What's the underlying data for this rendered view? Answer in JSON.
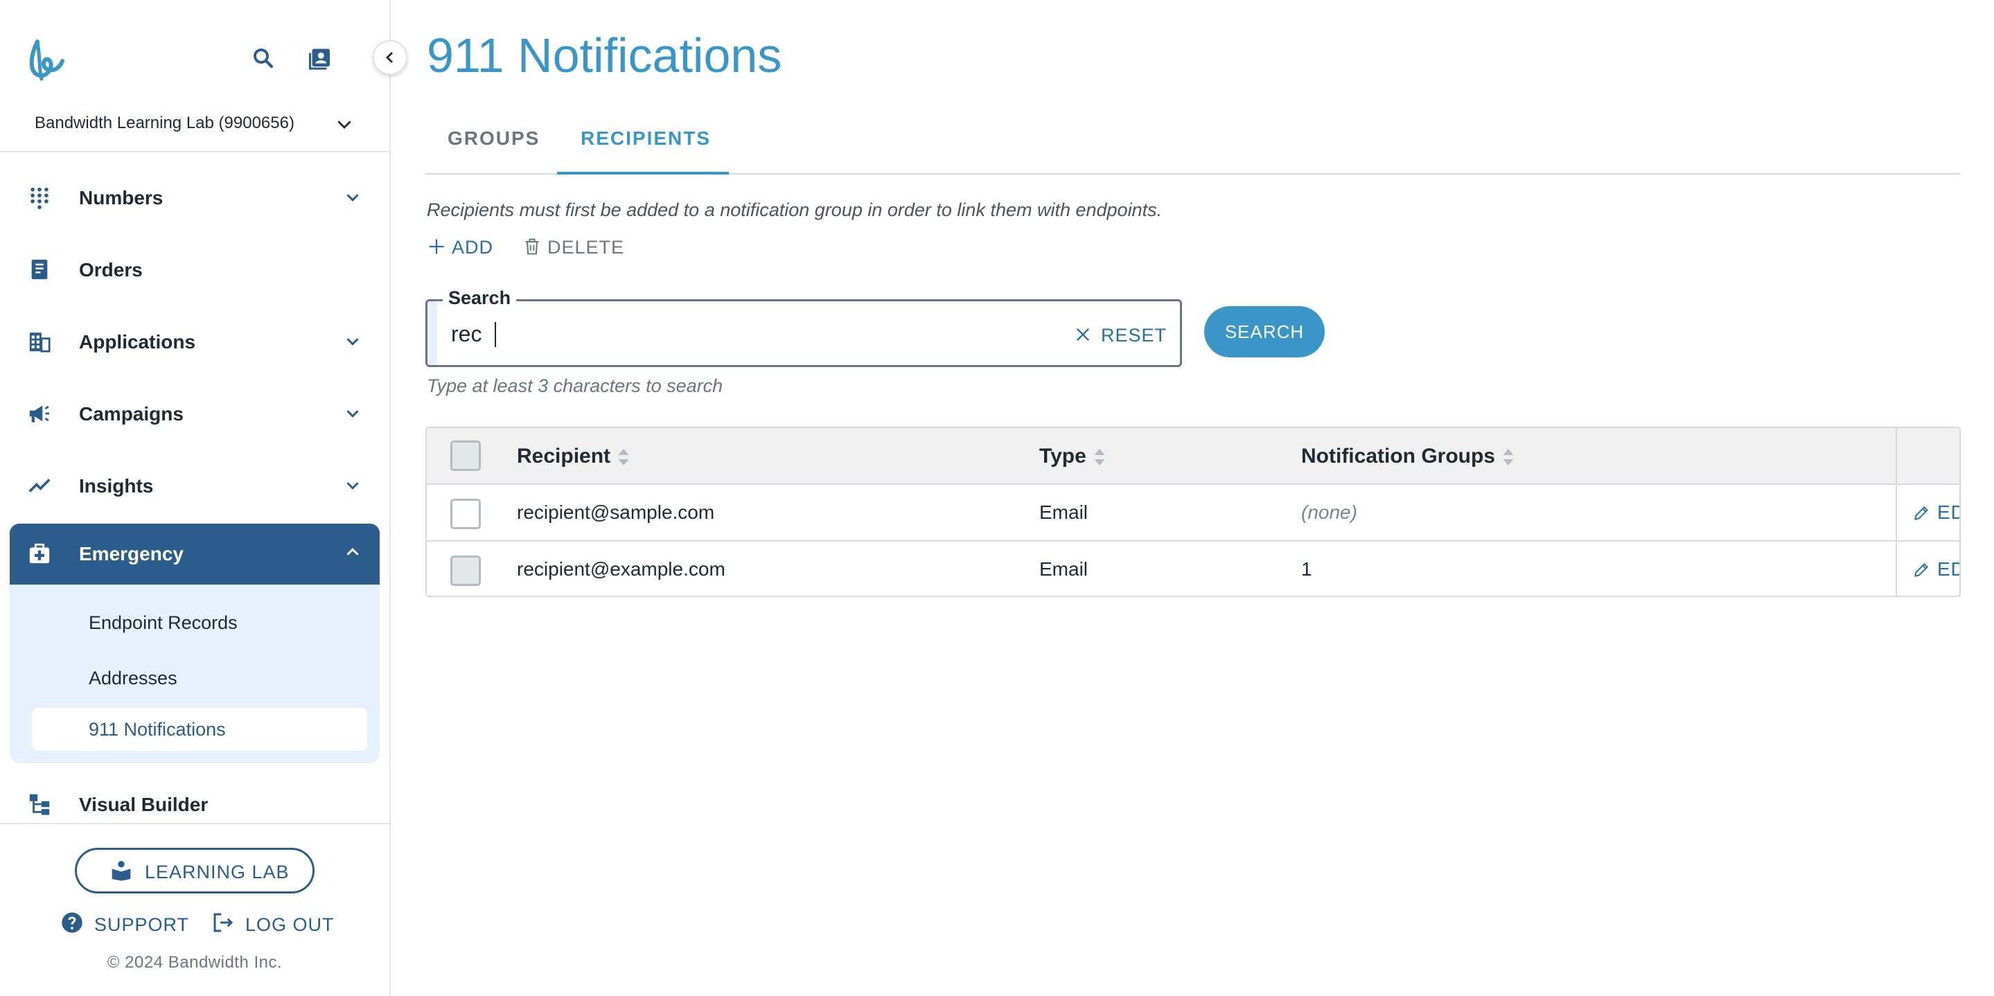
{
  "sidebar": {
    "account": "Bandwidth Learning Lab (9900656)",
    "nav": [
      {
        "label": "Numbers",
        "icon": "dialpad-icon"
      },
      {
        "label": "Orders",
        "icon": "receipt-icon"
      },
      {
        "label": "Applications",
        "icon": "building-icon"
      },
      {
        "label": "Campaigns",
        "icon": "megaphone-icon"
      },
      {
        "label": "Insights",
        "icon": "trend-icon"
      },
      {
        "label": "Emergency",
        "icon": "medkit-icon"
      },
      {
        "label": "Visual Builder",
        "icon": "flow-icon"
      }
    ],
    "emergency_items": [
      "Endpoint Records",
      "Addresses",
      "911 Notifications"
    ],
    "learning_lab": "LEARNING LAB",
    "support": "SUPPORT",
    "logout": "LOG OUT",
    "copyright": "© 2024 Bandwidth Inc."
  },
  "main": {
    "title": "911 Notifications",
    "tabs": [
      "GROUPS",
      "RECIPIENTS"
    ],
    "active_tab": "RECIPIENTS",
    "hint": "Recipients must first be added to a notification group in order to link them with endpoints.",
    "actions": {
      "add": "ADD",
      "delete": "DELETE"
    },
    "search": {
      "legend": "Search",
      "value": "rec",
      "reset": "RESET",
      "button": "SEARCH",
      "help": "Type at least 3 characters to search"
    },
    "table": {
      "headers": [
        "Recipient",
        "Type",
        "Notification Groups"
      ],
      "rows": [
        {
          "recipient": "recipient@sample.com",
          "type": "Email",
          "groups": "(none)",
          "edit": "EDIT"
        },
        {
          "recipient": "recipient@example.com",
          "type": "Email",
          "groups": "1",
          "edit": "EDIT"
        }
      ]
    }
  },
  "colors": {
    "accent": "#3b96c8",
    "nav_active": "#2a5d8c",
    "submenu_bg": "#e6f1fb",
    "link": "#2a6f9e"
  }
}
